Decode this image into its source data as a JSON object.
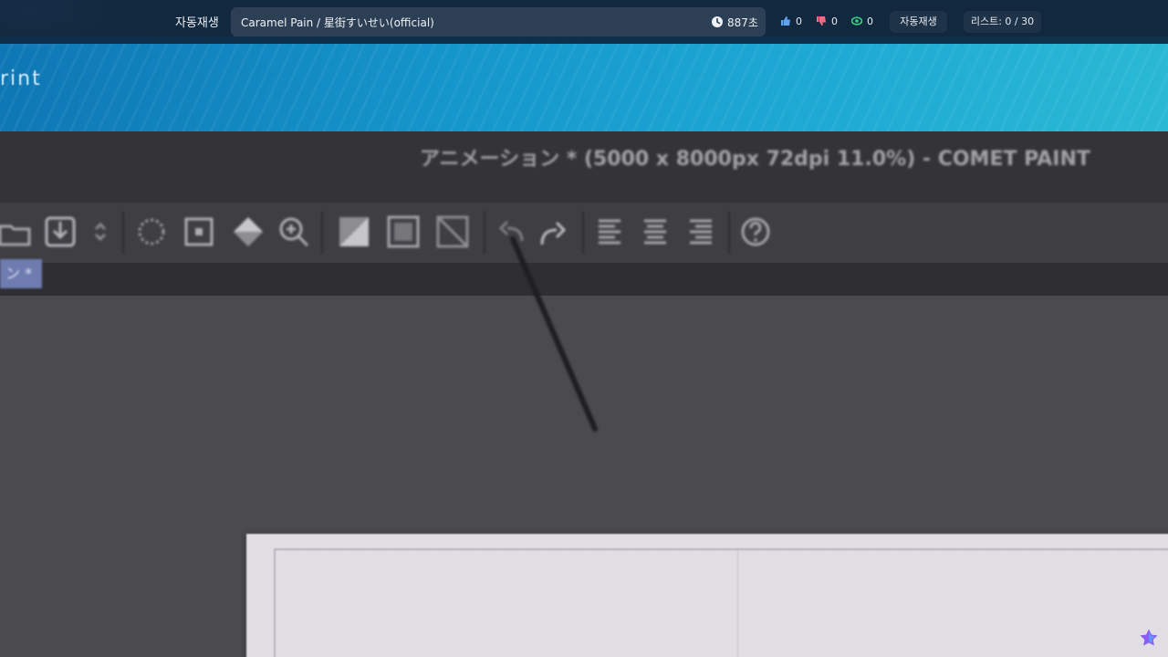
{
  "video_frame": {
    "brand_fragment": "rint",
    "window_title": "アニメーション * (5000 x 8000px 72dpi 11.0%) - COMET PAINT",
    "document_tab_label": "ン *",
    "toolbar_icons": [
      "folder-open-icon",
      "save-icon",
      "spinner-arrows-icon",
      "lasso-select-icon",
      "transform-select-icon",
      "fill-bucket-icon",
      "zoom-icon",
      "invert-selection-icon",
      "select-all-icon",
      "deselect-icon",
      "undo-icon",
      "redo-icon",
      "align-left-icon",
      "align-center-icon",
      "align-right-icon",
      "help-icon"
    ]
  },
  "topbar": {
    "autoplay_label": "자동재생",
    "track_title": "Caramel Pain / 星街すいせい(official)",
    "duration": "887초",
    "likes": "0",
    "dislikes": "0",
    "views": "0",
    "autoplay_button": "자동재생",
    "playlist_counter": "리스트: 0 / 30"
  },
  "colors": {
    "topbar_bg": "#0d263e",
    "pill_bg": "#2d3f55",
    "like": "#5ea2f0",
    "dislike": "#f06c84",
    "view": "#35d07f",
    "star": "#8a5cf6"
  }
}
